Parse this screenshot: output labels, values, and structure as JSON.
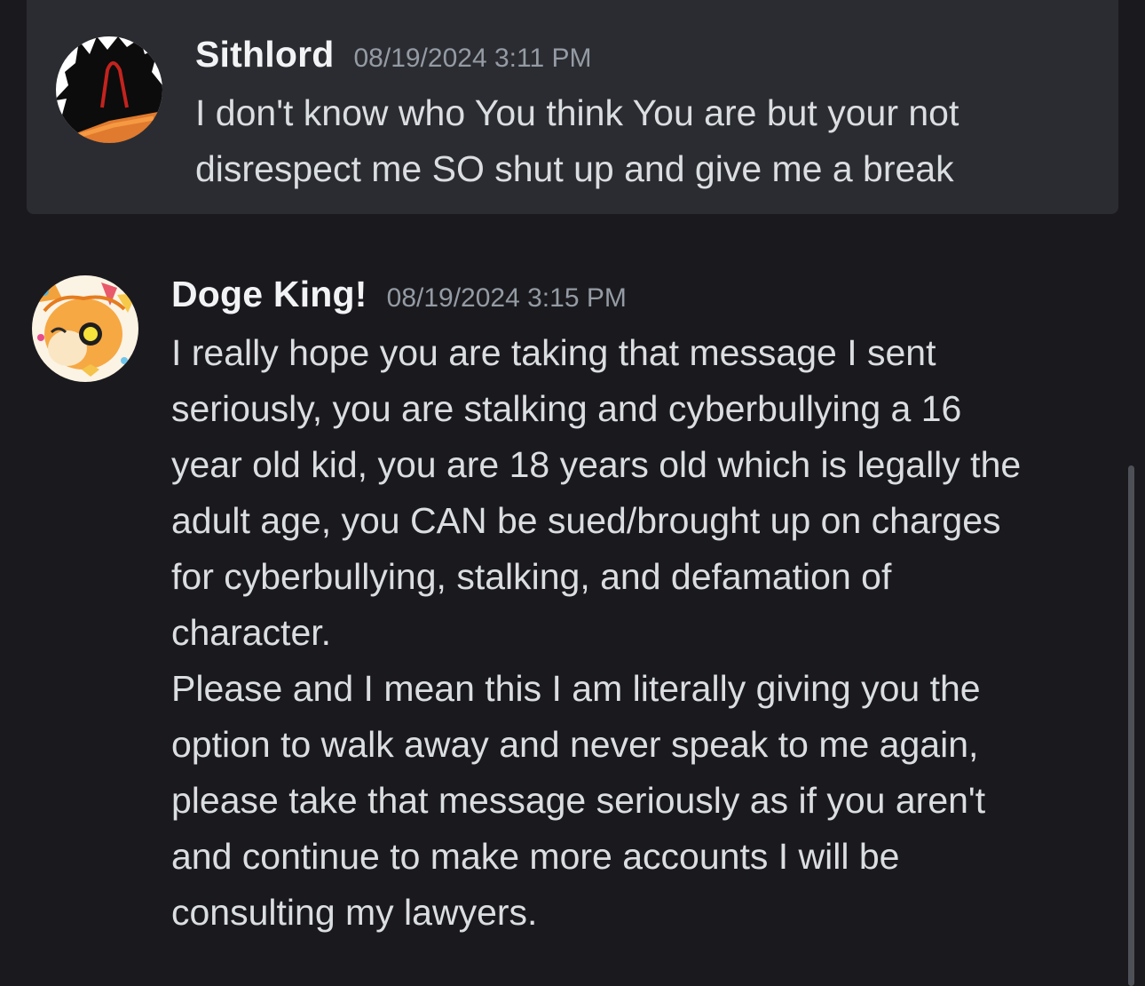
{
  "messages": [
    {
      "username": "Sithlord",
      "timestamp": "08/19/2024 3:11 PM",
      "text": "I don't know who You think You are but your not\ndisrespect me SO shut up and give me a break",
      "avatar_icon": "dark-spiky-character-avatar"
    },
    {
      "username": "Doge King!",
      "timestamp": "08/19/2024 3:15 PM",
      "text": "I really hope you are taking that message I sent\nseriously, you are stalking and cyberbullying a 16\nyear old kid, you are 18 years old which is legally the\nadult age, you CAN be sued/brought up on charges\nfor cyberbullying, stalking, and defamation of\ncharacter.\nPlease and I mean this I am literally giving you the\noption to walk away and never speak to me again,\nplease take that message seriously as if you aren't\nand continue to make more accounts I will be\nconsulting my lawyers.",
      "avatar_icon": "orange-fox-character-avatar"
    }
  ],
  "colors": {
    "background": "#1a1a1e",
    "highlight_background": "#2b2c31",
    "username": "#f2f3f5",
    "timestamp": "#949ba4",
    "message_text": "#dbdee1"
  }
}
